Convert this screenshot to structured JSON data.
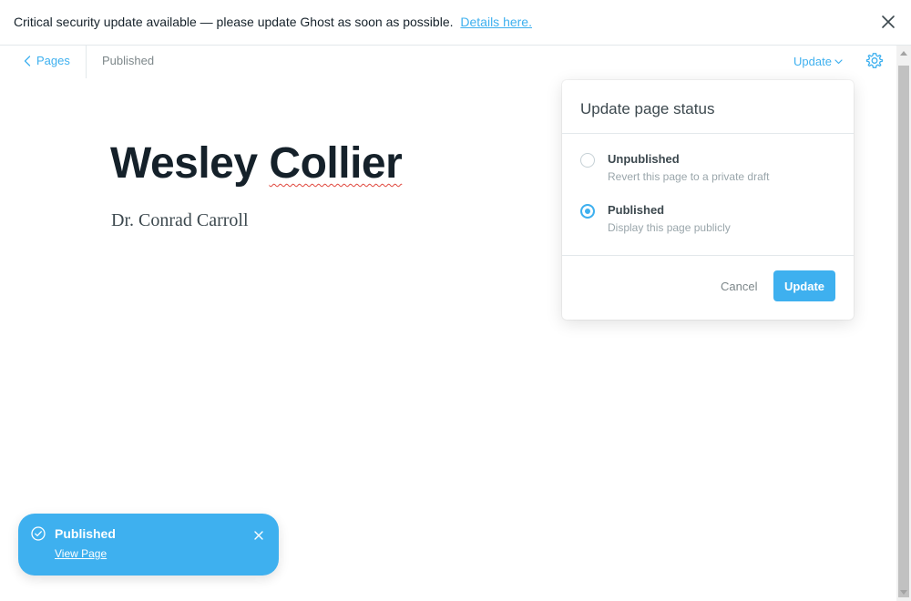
{
  "banner": {
    "message": "Critical security update available — please update Ghost as soon as possible.",
    "link_text": "Details here."
  },
  "topbar": {
    "back_label": "Pages",
    "status": "Published",
    "update_label": "Update"
  },
  "editor": {
    "title_first": "Wesley",
    "title_second": "Collier",
    "body": "Dr. Conrad Carroll"
  },
  "popover": {
    "title": "Update page status",
    "options": [
      {
        "label": "Unpublished",
        "description": "Revert this page to a private draft",
        "checked": false
      },
      {
        "label": "Published",
        "description": "Display this page publicly",
        "checked": true
      }
    ],
    "cancel_label": "Cancel",
    "update_label": "Update"
  },
  "toast": {
    "title": "Published",
    "link_text": "View Page"
  },
  "colors": {
    "accent": "#3eb0ef",
    "text": "#15212a",
    "muted": "#7d878a"
  },
  "icons": [
    "close-icon",
    "chevron-left-icon",
    "chevron-down-icon",
    "gear-icon",
    "check-circle-icon"
  ]
}
